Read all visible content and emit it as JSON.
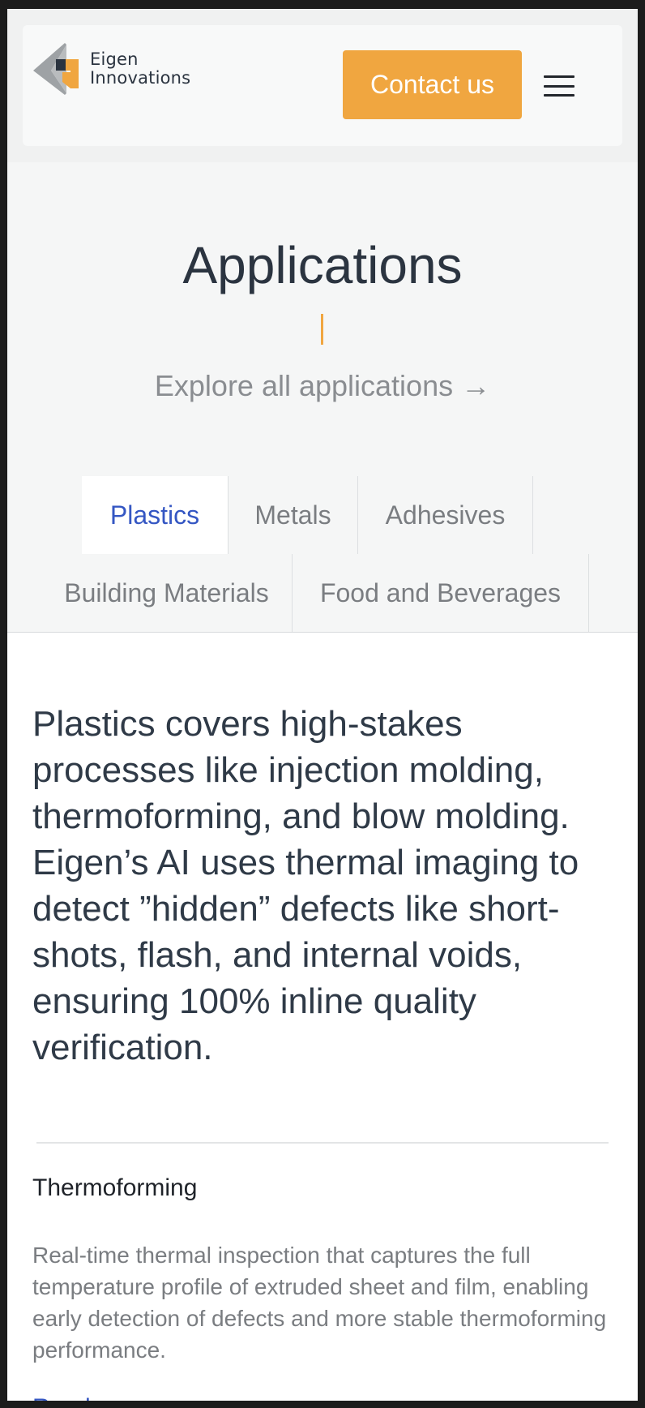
{
  "header": {
    "logo_line1": "Eigen",
    "logo_line2": "Innovations",
    "contact_label": "Contact us",
    "menu_icon": "hamburger-menu-icon"
  },
  "hero": {
    "title": "Applications",
    "explore_link": "Explore all applications →"
  },
  "tabs": [
    {
      "label": "Plastics",
      "active": true
    },
    {
      "label": "Metals",
      "active": false
    },
    {
      "label": "Adhesives",
      "active": false
    },
    {
      "label": "Building Materials",
      "active": false
    },
    {
      "label": "Food and Beverages",
      "active": false
    }
  ],
  "content": {
    "lead": "Plastics covers high-stakes processes like injection molding, thermoforming, and blow molding. Eigen’s AI uses thermal imaging to detect ”hidden” defects like short-shots, flash, and internal voids, ensuring 100% inline quality verification.",
    "item_title": "Thermoforming",
    "item_desc": "Real-time thermal inspection that captures the full temperature profile of extruded sheet and film, enabling early detection of defects and more stable thermoforming performance.",
    "read_more": "Read more →"
  },
  "colors": {
    "accent": "#f0a640",
    "link": "#3557c3",
    "heading": "#2b3440",
    "muted": "#8a8d91"
  }
}
